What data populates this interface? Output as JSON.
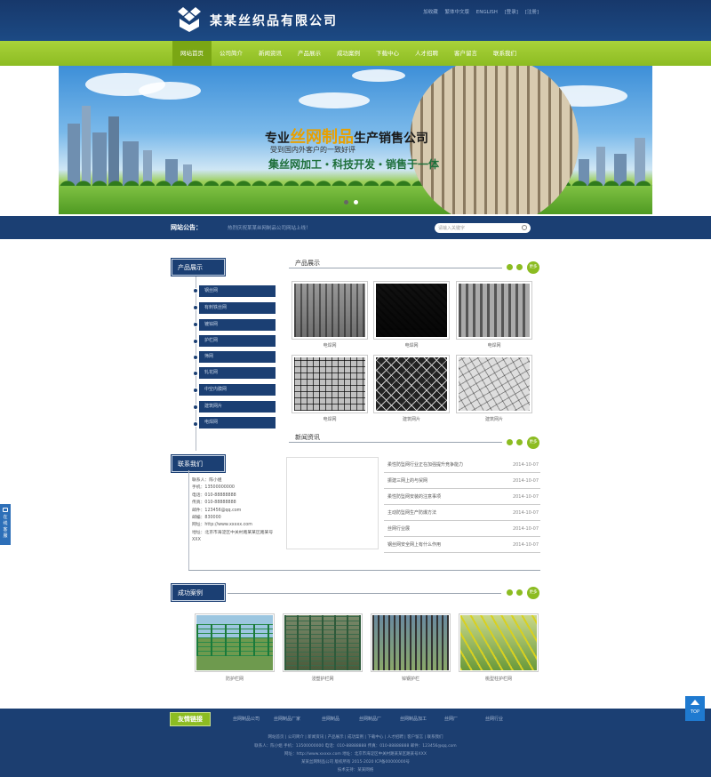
{
  "header": {
    "brand": "某某丝织品有限公司",
    "top_links": [
      "加收藏",
      "繁体中文版",
      "ENGLISH",
      "[登录]",
      "[注册]"
    ]
  },
  "nav": {
    "items": [
      "网站首页",
      "公司简介",
      "新闻资讯",
      "产品展示",
      "成功案例",
      "下载中心",
      "人才招聘",
      "客户留言",
      "联系我们"
    ]
  },
  "banner": {
    "line1_pre": "专业",
    "line1_hl": "丝网制品",
    "line1_post": "生产销售公司",
    "line2": "受到国内外客户的一致好评",
    "line3": "集丝网加工・科技开发・销售于一体"
  },
  "notice": {
    "label": "网站公告：",
    "text": "热烈庆祝某某丝网制品公司网站上线！",
    "search_placeholder": "请输入关键字"
  },
  "sidebar": {
    "products_title": "产品展示",
    "categories": [
      "钢丝网",
      "有刺铁丝网",
      "镀锌网",
      "护栏网",
      "筛网",
      "轧花网",
      "中空内膜网",
      "建筑网片",
      "电焊网"
    ],
    "contact_title": "联系我们",
    "contact_lines": [
      "联系人：陈小姐",
      "手机：13500000000",
      "电话：010-88888888",
      "传真：010-88888888",
      "邮件：123456@qq.com",
      "邮编：830000",
      "网址：http://www.xxxxx.com",
      "地址：北京市海淀区中关村路某某区路某号",
      "XXX"
    ]
  },
  "products": {
    "title": "产品展示",
    "more": "更多",
    "items": [
      "电焊网",
      "电焊网",
      "电焊网",
      "电焊网",
      "建筑网片",
      "建筑网片"
    ]
  },
  "news": {
    "title": "新闻资讯",
    "more": "更多",
    "items": [
      {
        "title": "柔性防坠网行业正在加强提升竞争能力",
        "date": "2014-10-07"
      },
      {
        "title": "振建三网上的与贸网",
        "date": "2014-10-07"
      },
      {
        "title": "柔性防坠网安装的注意事项",
        "date": "2014-10-07"
      },
      {
        "title": "主动防坠网生产防爆方法",
        "date": "2014-10-07"
      },
      {
        "title": "丝网行业展",
        "date": "2014-10-07"
      },
      {
        "title": "钢丝网安全网上有什么作用",
        "date": "2014-10-07"
      }
    ]
  },
  "cases": {
    "title": "成功案例",
    "more": "更多",
    "items": [
      "防护栏网",
      "浸塑护栏网",
      "锌钢护栏",
      "桃型柱护栏网"
    ]
  },
  "friend_links": {
    "title": "友情链接",
    "items": [
      "丝网制品公司",
      "丝网制品厂家",
      "丝网制品",
      "丝网制品厂",
      "丝网制品加工",
      "丝网厂",
      "丝网行业"
    ]
  },
  "footer": {
    "nav": "网站首页 | 公司简介 | 新闻资讯 | 产品展示 | 成功案例 | 下载中心 | 人才招聘 | 客户留言 | 联系我们",
    "line2": "联系人：陈小姐    手机：13500000000    电话：010-88888888    传真：010-88888888    邮件：123456@qq.com",
    "line3": "网址：http://www.xxxxx.com    地址：北京市海淀区中关村路某某区路某号XXX",
    "line4": "某某丝网制品公司    版权所有 2015-2020  ICP备00000000号",
    "line5": "技术支持：某某网络"
  },
  "floating": {
    "service": "在线客服",
    "top": "TOP"
  },
  "colors": {
    "navy": "#1b3f73",
    "green": "#8cbc22"
  }
}
